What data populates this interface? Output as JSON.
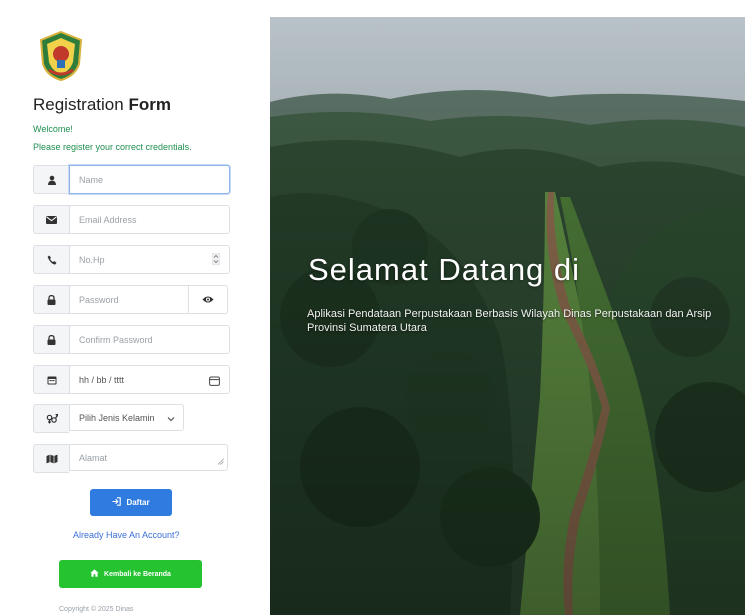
{
  "form": {
    "title_light": "Registration",
    "title_bold": "Form",
    "welcome": "Welcome!",
    "subtitle": "Please register your correct credentials.",
    "name_placeholder": "Name",
    "email_placeholder": "Email Address",
    "phone_placeholder": "No.Hp",
    "password_placeholder": "Password",
    "confirm_password_placeholder": "Confirm Password",
    "date_placeholder": "hh / bb / tttt",
    "gender_selected": "Pilih Jenis Kelamin",
    "address_placeholder": "Alamat",
    "submit_label": "Daftar",
    "login_link": "Already Have An Account?",
    "home_button": "Kembali ke Beranda",
    "copyright": "Copyright © 2025 Dinas"
  },
  "hero": {
    "title": "Selamat Datang di",
    "description": "Aplikasi Pendataan Perpustakaan Berbasis Wilayah Dinas Perpustakaan dan Arsip Provinsi Sumatera Utara"
  },
  "icons": {
    "logo": "provincial-emblem",
    "name": "user-icon",
    "email": "envelope-icon",
    "phone": "phone-icon",
    "password": "lock-icon",
    "confirm": "lock-icon",
    "date": "calendar-icon",
    "gender": "gender-icon",
    "address": "map-icon"
  },
  "colors": {
    "primary": "#2f7be0",
    "success": "#25c330",
    "welcome_text": "#1e8f4f",
    "link": "#3b6fd6"
  }
}
